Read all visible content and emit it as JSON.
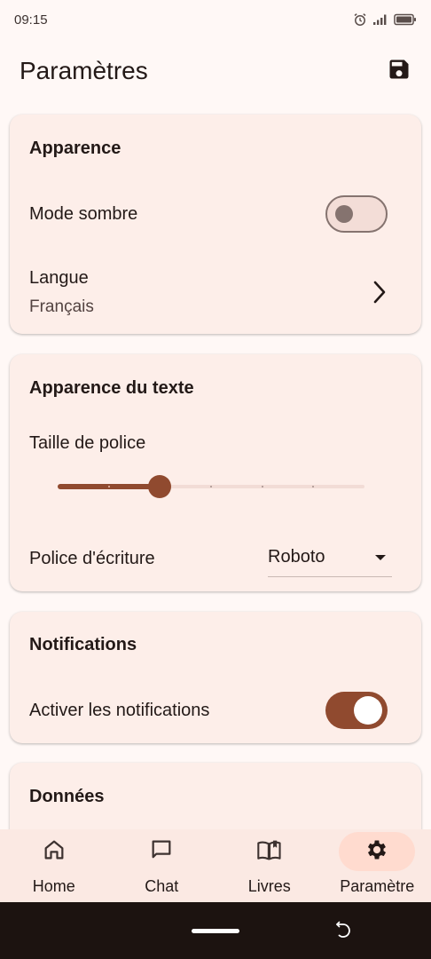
{
  "status_bar": {
    "time": "09:15"
  },
  "app_bar": {
    "title": "Paramètres"
  },
  "sections": {
    "appearance": {
      "title": "Apparence",
      "dark_mode": {
        "label": "Mode sombre",
        "enabled": false
      },
      "language": {
        "label": "Langue",
        "value": "Français"
      }
    },
    "text_appearance": {
      "title": "Apparence du texte",
      "font_size": {
        "label": "Taille de police",
        "value_fraction": 0.333,
        "steps": 6
      },
      "font_family": {
        "label": "Police d'écriture",
        "value": "Roboto"
      }
    },
    "notifications": {
      "title": "Notifications",
      "enable": {
        "label": "Activer les notifications",
        "enabled": true
      }
    },
    "data": {
      "title": "Données"
    }
  },
  "bottom_nav": {
    "items": [
      {
        "label": "Home",
        "icon": "home-icon"
      },
      {
        "label": "Chat",
        "icon": "chat-icon"
      },
      {
        "label": "Livres",
        "icon": "book-icon"
      },
      {
        "label": "Paramètre",
        "icon": "gear-icon",
        "active": true
      }
    ]
  },
  "colors": {
    "primary": "#904a2f",
    "surface": "#fff8f6",
    "card": "#fdeee9",
    "nav_indicator": "#ffdbcf"
  }
}
